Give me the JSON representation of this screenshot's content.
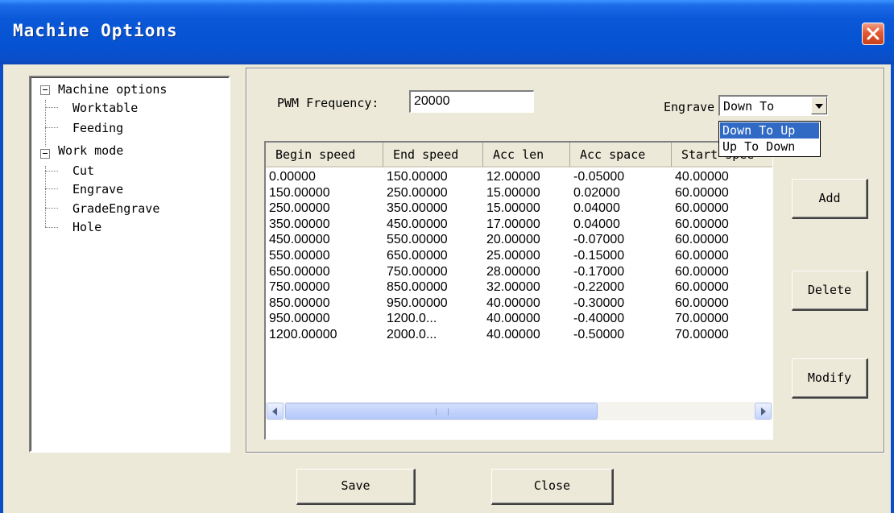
{
  "window": {
    "title": "Machine Options"
  },
  "tree": {
    "items": [
      {
        "label": "Machine options"
      },
      {
        "label": "Worktable"
      },
      {
        "label": "Feeding"
      },
      {
        "label": "Work mode"
      },
      {
        "label": "Cut"
      },
      {
        "label": "Engrave"
      },
      {
        "label": "GradeEngrave"
      },
      {
        "label": "Hole"
      }
    ]
  },
  "settings": {
    "pwm_label": "PWM Frequency:",
    "pwm_value": "20000",
    "engrave_label": "Engrave",
    "engrave_selected": "Down To",
    "engrave_options": [
      "Down To Up",
      "Up To Down"
    ]
  },
  "table": {
    "columns": [
      "Begin speed",
      "End speed",
      "Acc len",
      "Acc space",
      "Start spee"
    ],
    "rows": [
      [
        "0.00000",
        "150.00000",
        "12.00000",
        "-0.05000",
        "40.00000"
      ],
      [
        "150.00000",
        "250.00000",
        "15.00000",
        "0.02000",
        "60.00000"
      ],
      [
        "250.00000",
        "350.00000",
        "15.00000",
        "0.04000",
        "60.00000"
      ],
      [
        "350.00000",
        "450.00000",
        "17.00000",
        "0.04000",
        "60.00000"
      ],
      [
        "450.00000",
        "550.00000",
        "20.00000",
        "-0.07000",
        "60.00000"
      ],
      [
        "550.00000",
        "650.00000",
        "25.00000",
        "-0.15000",
        "60.00000"
      ],
      [
        "650.00000",
        "750.00000",
        "28.00000",
        "-0.17000",
        "60.00000"
      ],
      [
        "750.00000",
        "850.00000",
        "32.00000",
        "-0.22000",
        "60.00000"
      ],
      [
        "850.00000",
        "950.00000",
        "40.00000",
        "-0.30000",
        "60.00000"
      ],
      [
        "950.00000",
        "1200.0...",
        "40.00000",
        "-0.40000",
        "70.00000"
      ],
      [
        "1200.00000",
        "2000.0...",
        "40.00000",
        "-0.50000",
        "70.00000"
      ]
    ]
  },
  "buttons": {
    "add": "Add",
    "delete": "Delete",
    "modify": "Modify",
    "save": "Save",
    "close": "Close"
  },
  "colors": {
    "title_bar": "#0553d3",
    "dialog_bg": "#ece9d8",
    "selection": "#316ac5",
    "close_button": "#e35a34"
  }
}
